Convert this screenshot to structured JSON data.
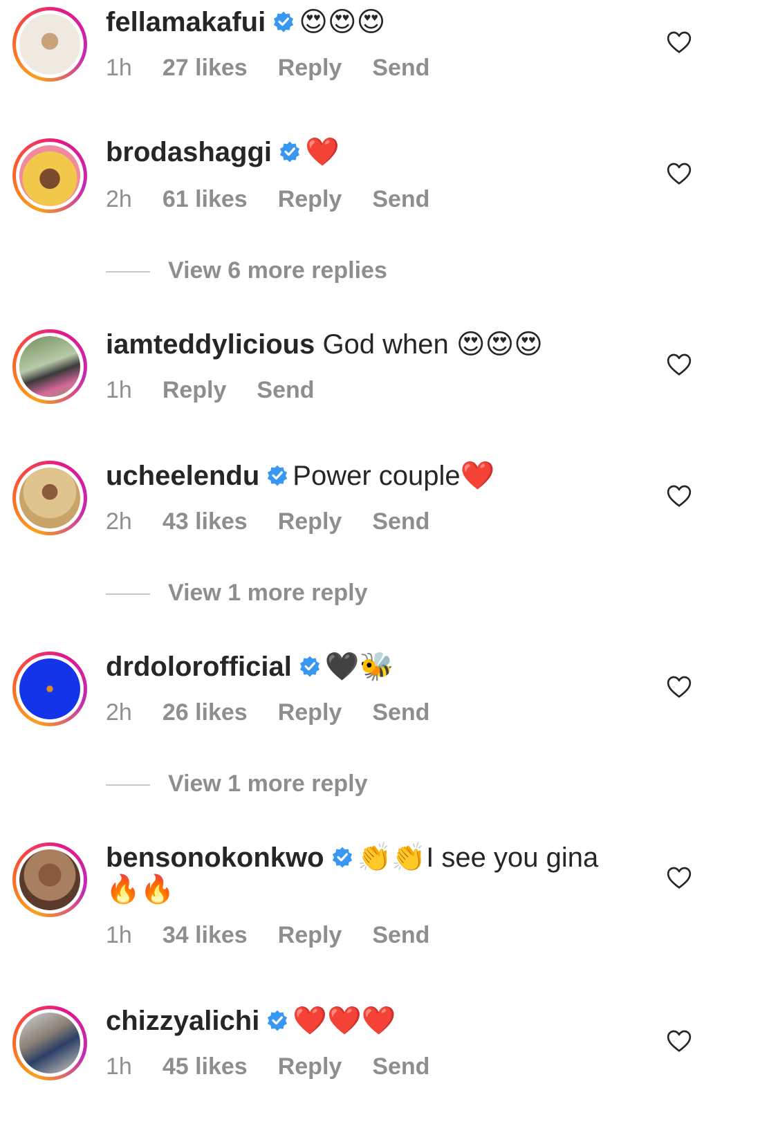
{
  "colors": {
    "text": "#262626",
    "secondary": "#8e8e8e",
    "verified": "#3897f0",
    "ring": [
      "#f9a11b",
      "#e4178a",
      "#c12bb6"
    ]
  },
  "icons": {
    "verified": "verified-badge-icon",
    "like": "heart-outline-icon"
  },
  "comments": [
    {
      "username": "fellamakafui",
      "verified": true,
      "text": "",
      "emoji": "😍😍😍",
      "time": "1h",
      "likes": "27 likes",
      "reply": "Reply",
      "send": "Send"
    },
    {
      "username": "brodashaggi",
      "verified": true,
      "text": "",
      "emoji": "❤️",
      "time": "2h",
      "likes": "61 likes",
      "reply": "Reply",
      "send": "Send",
      "view_more": "View 6 more replies"
    },
    {
      "username": "iamteddylicious",
      "verified": false,
      "text": "God when",
      "emoji": "😍😍😍",
      "time": "1h",
      "likes": "",
      "reply": "Reply",
      "send": "Send"
    },
    {
      "username": "ucheelendu",
      "verified": true,
      "text": "Power couple",
      "emoji": "❤️",
      "time": "2h",
      "likes": "43 likes",
      "reply": "Reply",
      "send": "Send",
      "view_more": "View 1 more reply"
    },
    {
      "username": "drdolorofficial",
      "verified": true,
      "text": "",
      "emoji": "🖤🐝",
      "time": "2h",
      "likes": "26 likes",
      "reply": "Reply",
      "send": "Send",
      "view_more": "View 1 more reply"
    },
    {
      "username": "bensonokonkwo",
      "verified": true,
      "text": "I see you gina",
      "emoji": "👏👏",
      "continuation": "🔥🔥",
      "time": "1h",
      "likes": "34 likes",
      "reply": "Reply",
      "send": "Send"
    },
    {
      "username": "chizzyalichi",
      "verified": true,
      "text": "",
      "emoji": "❤️❤️❤️",
      "time": "1h",
      "likes": "45 likes",
      "reply": "Reply",
      "send": "Send"
    }
  ]
}
